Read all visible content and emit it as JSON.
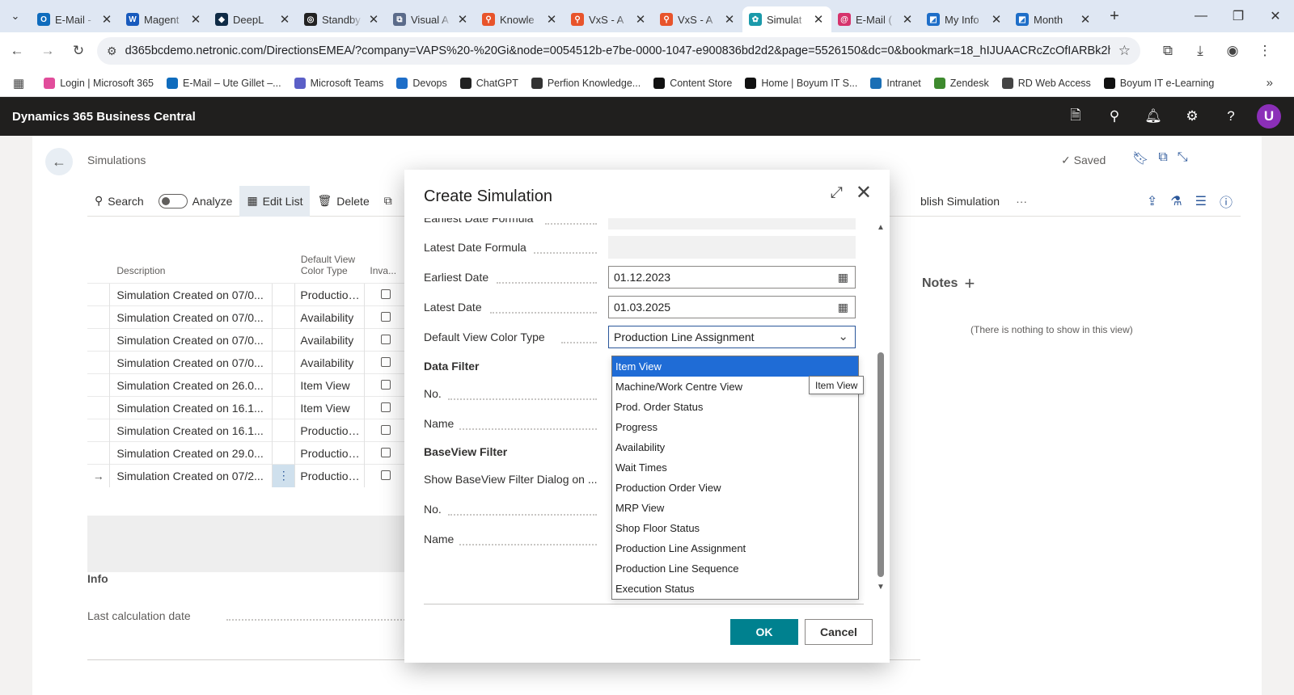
{
  "browser": {
    "tabs": [
      {
        "title": "E-Mail -",
        "color": "#0f6cbd",
        "glyph": "O"
      },
      {
        "title": "Magent",
        "color": "#185abd",
        "glyph": "W"
      },
      {
        "title": "DeepL",
        "color": "#0f2b46",
        "glyph": "◆"
      },
      {
        "title": "Standby",
        "color": "#222222",
        "glyph": "◎"
      },
      {
        "title": "Visual A",
        "color": "#5b6b8a",
        "glyph": "⧉"
      },
      {
        "title": "Knowle",
        "color": "#e8542b",
        "glyph": "⚲"
      },
      {
        "title": "VxS - A",
        "color": "#e8542b",
        "glyph": "⚲"
      },
      {
        "title": "VxS - A",
        "color": "#e8542b",
        "glyph": "⚲"
      },
      {
        "title": "Simulat",
        "color": "#1b9aaa",
        "glyph": "✿"
      },
      {
        "title": "E-Mail (",
        "color": "#d6336c",
        "glyph": "@"
      },
      {
        "title": "My Info",
        "color": "#1e6ec8",
        "glyph": "◩"
      },
      {
        "title": "Month",
        "color": "#1e6ec8",
        "glyph": "◩"
      }
    ],
    "active_tab_index": 8,
    "url": "d365bcdemo.netronic.com/DirectionsEMEA/?company=VAPS%20-%20Gi&node=0054512b-e7be-0000-1047-e900836bd2d2&page=5526150&dc=0&bookmark=18_hIJUAACRcZcOfIARBk2hqBRl_o...",
    "bookmarks": [
      {
        "label": "Login | Microsoft 365",
        "color": "#e14d9b"
      },
      {
        "label": "E-Mail – Ute Gillet –...",
        "color": "#0f6cbd"
      },
      {
        "label": "Microsoft Teams",
        "color": "#5b5fc7"
      },
      {
        "label": "Devops",
        "color": "#1e6ec8"
      },
      {
        "label": "ChatGPT",
        "color": "#222222"
      },
      {
        "label": "Perfion Knowledge...",
        "color": "#333333"
      },
      {
        "label": "Content Store",
        "color": "#111111"
      },
      {
        "label": "Home | Boyum IT S...",
        "color": "#111111"
      },
      {
        "label": "Intranet",
        "color": "#1b6fb5"
      },
      {
        "label": "Zendesk",
        "color": "#3e8a2e"
      },
      {
        "label": "RD Web Access",
        "color": "#444444"
      },
      {
        "label": "Boyum IT e-Learning",
        "color": "#111111"
      }
    ]
  },
  "app": {
    "brand": "Dynamics 365 Business Central",
    "avatar_initial": "U",
    "avatar_color": "#8b2fb8"
  },
  "page": {
    "title": "Simulations",
    "saved_label": "Saved",
    "commands": {
      "search": "Search",
      "analyze": "Analyze",
      "edit_list": "Edit List",
      "delete": "Delete",
      "publish": "blish Simulation",
      "more": "···"
    },
    "grid": {
      "headers": {
        "description": "Description",
        "default_view_line1": "Default View",
        "default_view_line2": "Color Type",
        "invalid": "Inva..."
      },
      "rows": [
        {
          "description": "Simulation Created on 07/0...",
          "view": "Production...",
          "current": false
        },
        {
          "description": "Simulation Created on 07/0...",
          "view": "Availability",
          "current": false
        },
        {
          "description": "Simulation Created on 07/0...",
          "view": "Availability",
          "current": false
        },
        {
          "description": "Simulation Created on 07/0...",
          "view": "Availability",
          "current": false
        },
        {
          "description": "Simulation Created on 26.0...",
          "view": "Item View",
          "current": false
        },
        {
          "description": "Simulation Created on 16.1...",
          "view": "Item View",
          "current": false
        },
        {
          "description": "Simulation Created on 16.1...",
          "view": "Production...",
          "current": false
        },
        {
          "description": "Simulation Created on 29.0...",
          "view": "Production...",
          "current": false
        },
        {
          "description": "Simulation Created on 07/2...",
          "view": "Production...",
          "current": true
        }
      ]
    },
    "info": {
      "header": "Info",
      "last_calc_label": "Last calculation date"
    },
    "notes": {
      "header": "Notes",
      "empty": "(There is nothing to show in this view)"
    }
  },
  "dialog": {
    "title": "Create Simulation",
    "fields": {
      "earliest_formula_label": "Earliest Date Formula",
      "latest_formula_label": "Latest Date Formula",
      "earliest_date_label": "Earliest Date",
      "earliest_date_value": "01.12.2023",
      "latest_date_label": "Latest Date",
      "latest_date_value": "01.03.2025",
      "color_type_label": "Default View Color Type",
      "color_type_value": "Production Line Assignment"
    },
    "data_filter": {
      "header": "Data Filter",
      "no_label": "No.",
      "name_label": "Name"
    },
    "baseview_filter": {
      "header": "BaseView Filter",
      "show_dialog_label": "Show BaseView Filter Dialog on ...",
      "no_label": "No.",
      "name_label": "Name"
    },
    "ok_label": "OK",
    "cancel_label": "Cancel",
    "ok_color": "#00818f"
  },
  "dropdown": {
    "options": [
      "Item View",
      "Machine/Work Centre View",
      "Prod. Order Status",
      "Progress",
      "Availability",
      "Wait Times",
      "Production Order View",
      "MRP View",
      "Shop Floor Status",
      "Production Line Assignment",
      "Production Line Sequence",
      "Execution Status"
    ],
    "highlighted_index": 0,
    "tooltip": "Item View"
  }
}
